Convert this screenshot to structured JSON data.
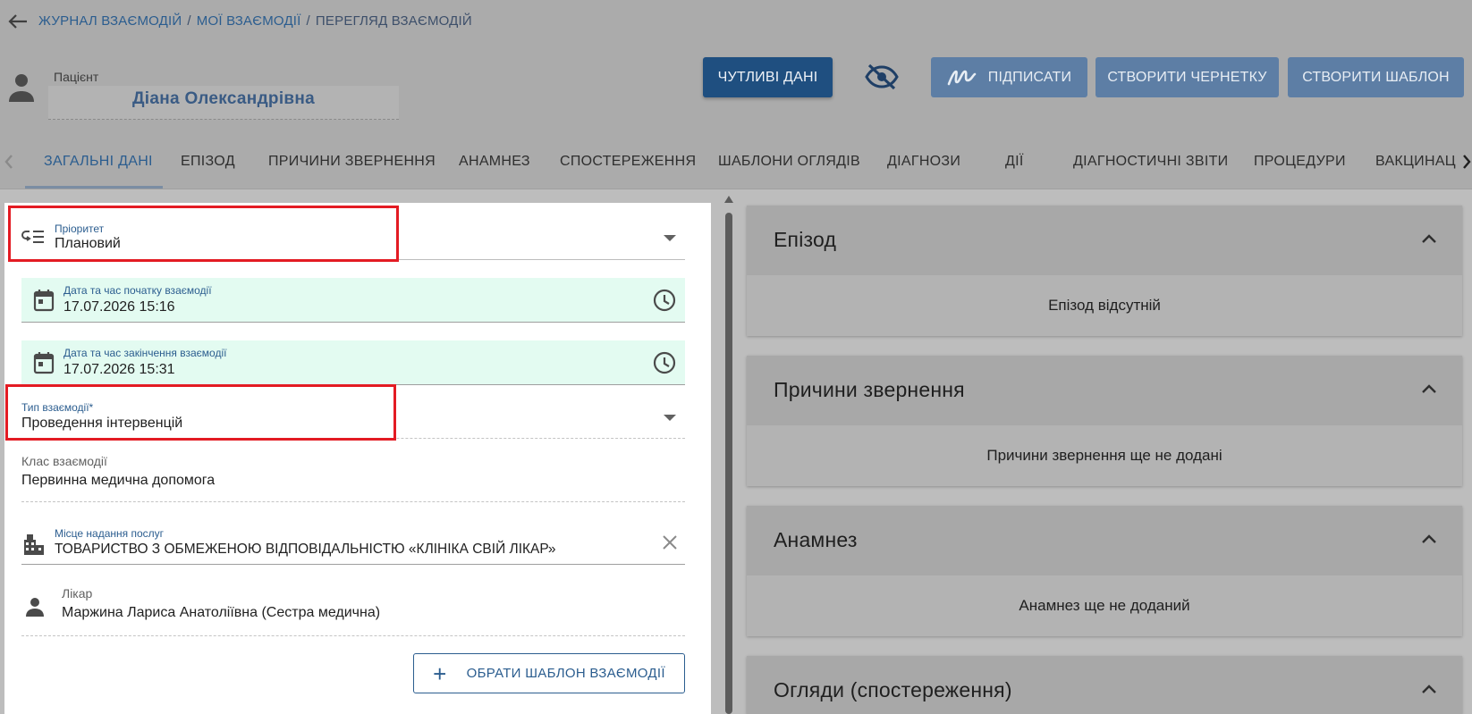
{
  "breadcrumb": {
    "items": [
      "ЖУРНАЛ ВЗАЄМОДІЙ",
      "МОЇ ВЗАЄМОДІЇ",
      "ПЕРЕГЛЯД ВЗАЄМОДІЙ"
    ],
    "separator": "/"
  },
  "patient": {
    "label": "Пацієнт",
    "name": "Діана Олександрівна"
  },
  "toolbar": {
    "sensitive_label": "ЧУТЛИВІ ДАНІ",
    "sign_label": "ПІДПИСАТИ",
    "draft_label": "СТВОРИТИ ЧЕРНЕТКУ",
    "template_label": "СТВОРИТИ ШАБЛОН"
  },
  "tabs": [
    {
      "label": "ЗАГАЛЬНІ ДАНІ",
      "active": true
    },
    {
      "label": "ЕПІЗОД"
    },
    {
      "label": "ПРИЧИНИ ЗВЕРНЕННЯ"
    },
    {
      "label": "АНАМНЕЗ"
    },
    {
      "label": "СПОСТЕРЕЖЕННЯ"
    },
    {
      "label": "ШАБЛОНИ ОГЛЯДІВ"
    },
    {
      "label": "ДІАГНОЗИ"
    },
    {
      "label": "ДІЇ"
    },
    {
      "label": "ДІАГНОСТИЧНІ ЗВІТИ"
    },
    {
      "label": "ПРОЦЕДУРИ"
    },
    {
      "label": "ВАКЦИНАЦ"
    }
  ],
  "form": {
    "priority": {
      "label": "Пріоритет",
      "value": "Плановий"
    },
    "start": {
      "label": "Дата та час початку взаємодії",
      "value": "17.07.2026 15:16"
    },
    "end": {
      "label": "Дата та час закінчення взаємодії",
      "value": "17.07.2026 15:31"
    },
    "type": {
      "label": "Тип взаємодії*",
      "value": "Проведення інтервенцій"
    },
    "class": {
      "label": "Клас взаємодії",
      "value": "Первинна медична допомога"
    },
    "place": {
      "label": "Місце надання послуг",
      "value": "ТОВАРИСТВО З ОБМЕЖЕНОЮ ВІДПОВІДАЛЬНІСТЮ «КЛІНІКА СВІЙ ЛІКАР»"
    },
    "doctor": {
      "label": "Лікар",
      "value": "Маржина Лариса Анатоліївна (Сестра медична)"
    },
    "template_button": "ОБРАТИ ШАБЛОН ВЗАЄМОДІЇ"
  },
  "cards": [
    {
      "title": "Епізод",
      "empty": "Епізод відсутній"
    },
    {
      "title": "Причини звернення",
      "empty": "Причини звернення ще не додані"
    },
    {
      "title": "Анамнез",
      "empty": "Анамнез ще не доданий"
    },
    {
      "title": "Огляди (спостереження)",
      "empty": ""
    }
  ],
  "colors": {
    "accent": "#2b5d8f",
    "highlight_box": "#e31b23",
    "datetime_bg": "#e3fbf1"
  },
  "icons": [
    "back-arrow-icon",
    "person-icon",
    "eye-off-icon",
    "signature-icon",
    "priority-icon",
    "calendar-icon",
    "clock-icon",
    "building-icon",
    "close-icon",
    "chevron-up-icon",
    "chevron-left-icon",
    "chevron-right-icon",
    "plus-icon"
  ]
}
